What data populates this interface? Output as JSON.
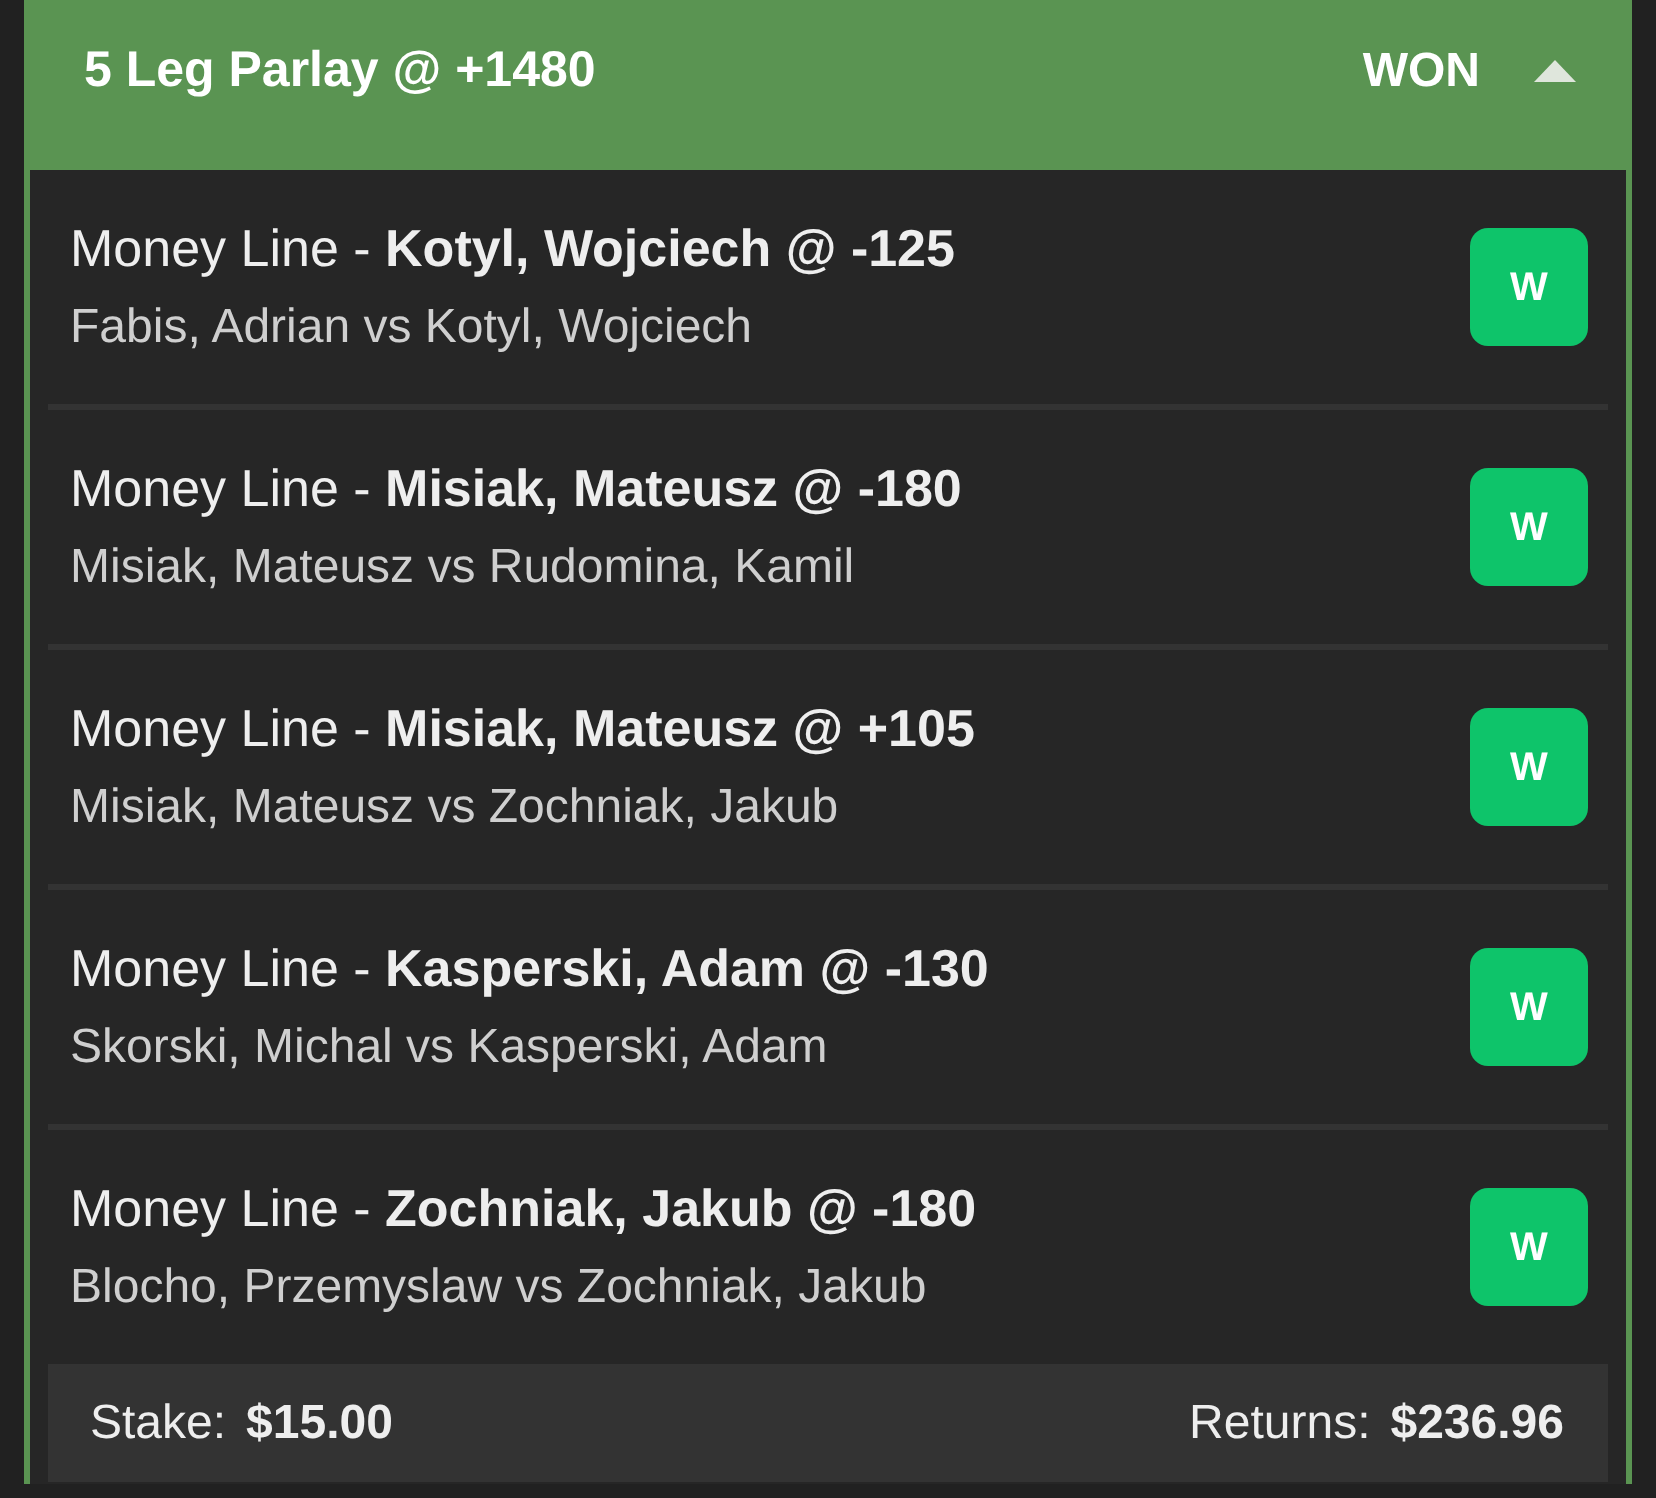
{
  "header": {
    "title": "5 Leg Parlay @ +1480",
    "status": "WON",
    "expanded": true
  },
  "legs": [
    {
      "selection": "Money Line - **Kotyl, Wojciech @ -125**",
      "matchup": "Fabis, Adrian vs Kotyl, Wojciech",
      "result": "W"
    },
    {
      "selection": "Money Line - **Misiak, Mateusz @ -180**",
      "matchup": "Misiak, Mateusz vs Rudomina, Kamil",
      "result": "W"
    },
    {
      "selection": "Money Line - **Misiak, Mateusz @ +105**",
      "matchup": "Misiak, Mateusz vs Zochniak, Jakub",
      "result": "W"
    },
    {
      "selection": "Money Line - **Kasperski, Adam @ -130**",
      "matchup": "Skorski, Michal vs Kasperski, Adam",
      "result": "W"
    },
    {
      "selection": "Money Line - **Zochniak, Jakub @ -180**",
      "matchup": "Blocho, Przemyslaw vs Zochniak, Jakub",
      "result": "W"
    }
  ],
  "footer": {
    "stake_label": "Stake:",
    "stake": "$15.00",
    "returns_label": "Returns:",
    "returns": "$236.96"
  }
}
